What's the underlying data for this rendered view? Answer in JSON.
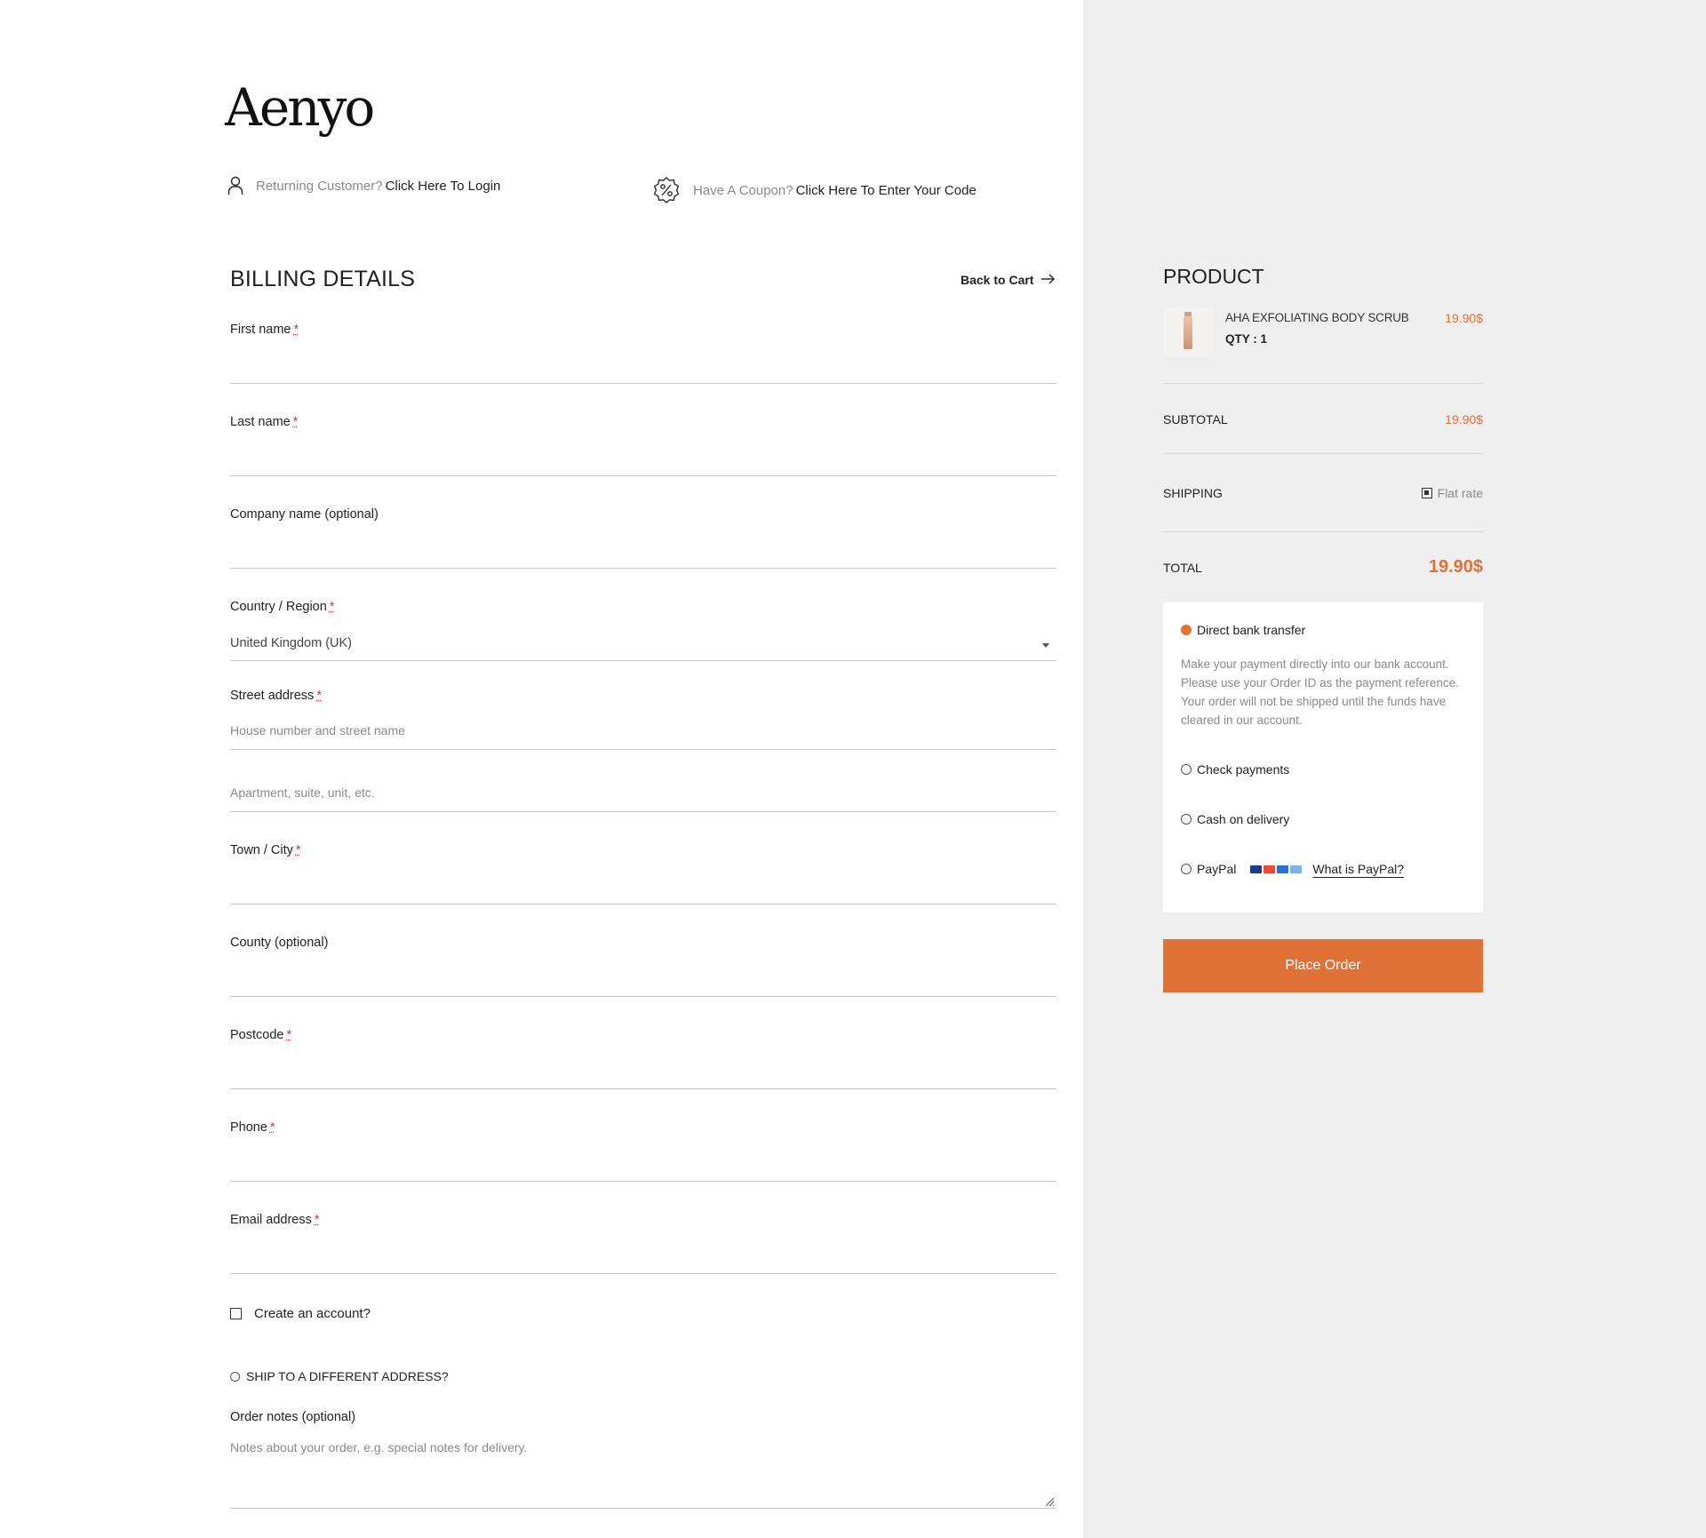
{
  "brand": {
    "logo_text": "Aenyo"
  },
  "notices": {
    "login": {
      "prefix": "Returning Customer?",
      "link": "Click Here To Login",
      "icon": "user-icon"
    },
    "coupon": {
      "prefix": "Have A Coupon?",
      "link": "Click Here To Enter Your Code",
      "icon": "discount-badge-icon"
    }
  },
  "billing": {
    "title": "BILLING DETAILS",
    "back_to_cart": "Back to Cart",
    "required_mark": "*",
    "fields": {
      "first_name": {
        "label": "First name",
        "required": true,
        "value": ""
      },
      "last_name": {
        "label": "Last name",
        "required": true,
        "value": ""
      },
      "company": {
        "label": "Company name (optional)",
        "required": false,
        "value": ""
      },
      "country": {
        "label": "Country / Region",
        "required": true,
        "value": "United Kingdom (UK)"
      },
      "street": {
        "label": "Street address",
        "required": true,
        "placeholder": "House number and street name",
        "placeholder2": "Apartment, suite, unit, etc."
      },
      "city": {
        "label": "Town / City",
        "required": true,
        "value": ""
      },
      "county": {
        "label": "County (optional)",
        "required": false,
        "value": ""
      },
      "postcode": {
        "label": "Postcode",
        "required": true,
        "value": ""
      },
      "phone": {
        "label": "Phone",
        "required": true,
        "value": ""
      },
      "email": {
        "label": "Email address",
        "required": true,
        "value": ""
      }
    },
    "create_account": {
      "label": "Create an account?",
      "checked": false
    },
    "ship_different": {
      "label": "SHIP TO A DIFFERENT ADDRESS?",
      "checked": false
    },
    "order_notes": {
      "label": "Order notes (optional)",
      "placeholder": "Notes about your order, e.g. special notes for delivery."
    }
  },
  "order": {
    "title": "PRODUCT",
    "item": {
      "name": "AHA EXFOLIATING BODY SCRUB",
      "qty": "QTY : 1",
      "price": "19.90$"
    },
    "subtotal": {
      "label": "SUBTOTAL",
      "value": "19.90$"
    },
    "shipping": {
      "label": "SHIPPING",
      "value": "Flat rate"
    },
    "total": {
      "label": "TOTAL",
      "value": "19.90$"
    }
  },
  "payment": {
    "selected": "bacs",
    "options": {
      "bacs": {
        "label": "Direct bank transfer",
        "description": "Make your payment directly into our bank account. Please use your Order ID as the payment reference. Your order will not be shipped until the funds have cleared in our account."
      },
      "cheque": {
        "label": "Check payments"
      },
      "cod": {
        "label": "Cash on delivery"
      },
      "paypal": {
        "label": "PayPal",
        "link": "What is PayPal?"
      }
    },
    "place_order": "Place Order"
  },
  "colors": {
    "accent": "#e07238",
    "panel_bg": "#efefef",
    "required": "#d9333f"
  }
}
